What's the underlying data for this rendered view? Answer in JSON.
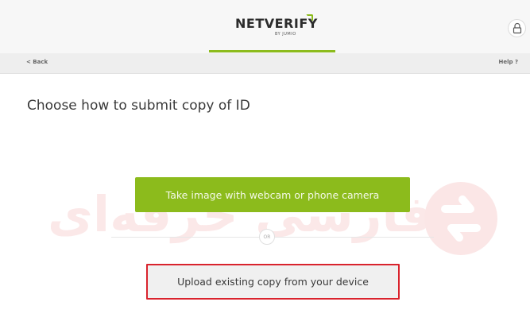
{
  "header": {
    "logo_text": "NETVERIFY",
    "logo_subtext": "BY JUMIO",
    "lock_icon": "lock-icon"
  },
  "subnav": {
    "back_label": "< Back",
    "help_label": "Help ?"
  },
  "main": {
    "title": "Choose how to submit copy of ID",
    "webcam_button_label": "Take image with webcam or phone camera",
    "or_label": "OR",
    "upload_button_label": "Upload existing copy from your device"
  },
  "watermark": {
    "text": "فارسی حرفه‌ای"
  },
  "colors": {
    "accent": "#8cbb1c",
    "highlight_border": "#d9232d",
    "header_bg": "#f7f7f7",
    "subnav_bg": "#eeeeee"
  }
}
